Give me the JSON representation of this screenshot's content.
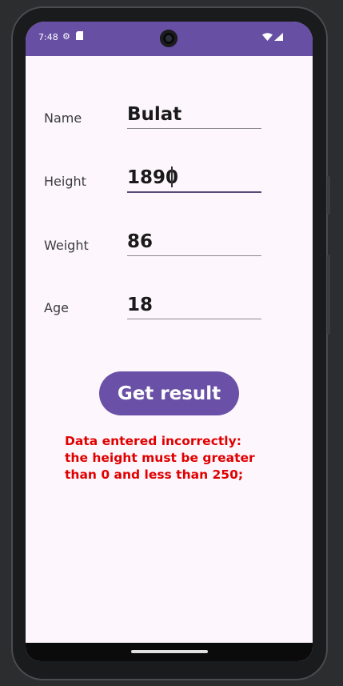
{
  "status_bar": {
    "time": "7:48",
    "icons": [
      "settings-icon",
      "sd-card-icon",
      "wifi-icon",
      "signal-icon"
    ]
  },
  "form": {
    "fields": [
      {
        "label": "Name",
        "value": "Bulat"
      },
      {
        "label": "Height",
        "value": "1890"
      },
      {
        "label": "Weight",
        "value": "86"
      },
      {
        "label": "Age",
        "value": "18"
      }
    ]
  },
  "actions": {
    "get_result_label": "Get result"
  },
  "error": {
    "message": "Data entered incorrectly:\nthe height must be greater\nthan 0 and less than 250;"
  },
  "colors": {
    "primary": "#6750a4",
    "error": "#e00000",
    "background": "#fdf7fd"
  }
}
